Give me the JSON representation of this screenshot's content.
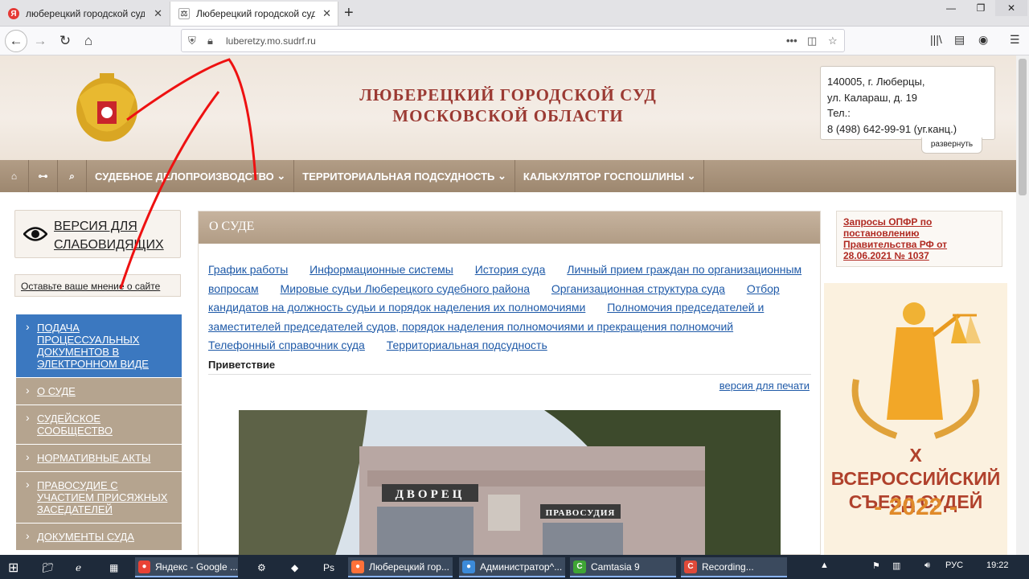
{
  "browser": {
    "tabs": [
      {
        "title": "люберецкий городской суд м",
        "active": false,
        "icon": "yandex-icon"
      },
      {
        "title": "Люберецкий городской суд М",
        "active": true,
        "icon": "site-icon"
      }
    ],
    "url": "luberetzy.mo.sudrf.ru"
  },
  "header": {
    "title_line1": "ЛЮБЕРЕЦКИЙ ГОРОДСКОЙ СУД",
    "title_line2": "МОСКОВСКОЙ ОБЛАСТИ",
    "address": {
      "line1": "140005, г. Люберцы,",
      "line2": "ул. Калараш, д. 19",
      "line3": "Тел.:",
      "line4": "8 (498) 642-99-91 (уг.канц.)"
    },
    "expand_label": "развернуть"
  },
  "topmenu": {
    "items": [
      "СУДЕБНОЕ ДЕЛОПРОИЗВОДСТВО",
      "ТЕРРИТОРИАЛЬНАЯ ПОДСУДНОСТЬ",
      "КАЛЬКУЛЯТОР ГОСПОШЛИНЫ"
    ]
  },
  "sidebar": {
    "vision_line1": "ВЕРСИЯ ДЛЯ",
    "vision_line2": "СЛАБОВИДЯЩИХ",
    "opinion": "Оставьте ваше мнение о сайте",
    "items": [
      "Подача процессуальных документов в электронном виде",
      "О суде",
      "Судейское сообщество",
      "Нормативные акты",
      "Правосудие с участием присяжных заседателей",
      "Документы суда"
    ]
  },
  "main": {
    "heading": "О СУДЕ",
    "links": [
      "График работы",
      "Информационные системы",
      "История суда",
      "Личный прием граждан по организационным вопросам",
      "Мировые судьи Люберецкого судебного района",
      "Организационная структура суда",
      "Отбор кандидатов на должность судьи и порядок наделения их полномочиями",
      "Полномочия председателей и заместителей председателей судов, порядок наделения полномочиями и прекращения полномочий",
      "Телефонный справочник суда",
      "Территориальная подсудность"
    ],
    "greeting": "Приветствие",
    "print_version": "версия для печати",
    "photo_sign1": "ДВОРЕЦ",
    "photo_sign2": "ПРАВОСУДИЯ"
  },
  "right": {
    "notice": "Запросы ОПФР по постановлению Правительства РФ от 28.06.2021 № 1037",
    "banner_line1": "X ВСЕРОССИЙСКИЙ",
    "banner_line2": "СЪЕЗД СУДЕЙ",
    "banner_year": "2022"
  },
  "taskbar": {
    "apps": [
      {
        "label": "Яндекс - Google ...",
        "color": "#e94235"
      },
      {
        "label": "Люберецкий гор...",
        "color": "#ff7139"
      },
      {
        "label": "Администратор^...",
        "color": "#3c8ad8"
      },
      {
        "label": "Camtasia 9",
        "color": "#3fa535"
      },
      {
        "label": "Recording...",
        "color": "#e04a3a"
      }
    ],
    "lang": "РУС",
    "time": "19:22"
  },
  "colors": {
    "accent_red": "#9b3a33",
    "link_blue": "#1f5aa8",
    "menu_brown": "#a8937c",
    "active_blue": "#3b78c0"
  }
}
